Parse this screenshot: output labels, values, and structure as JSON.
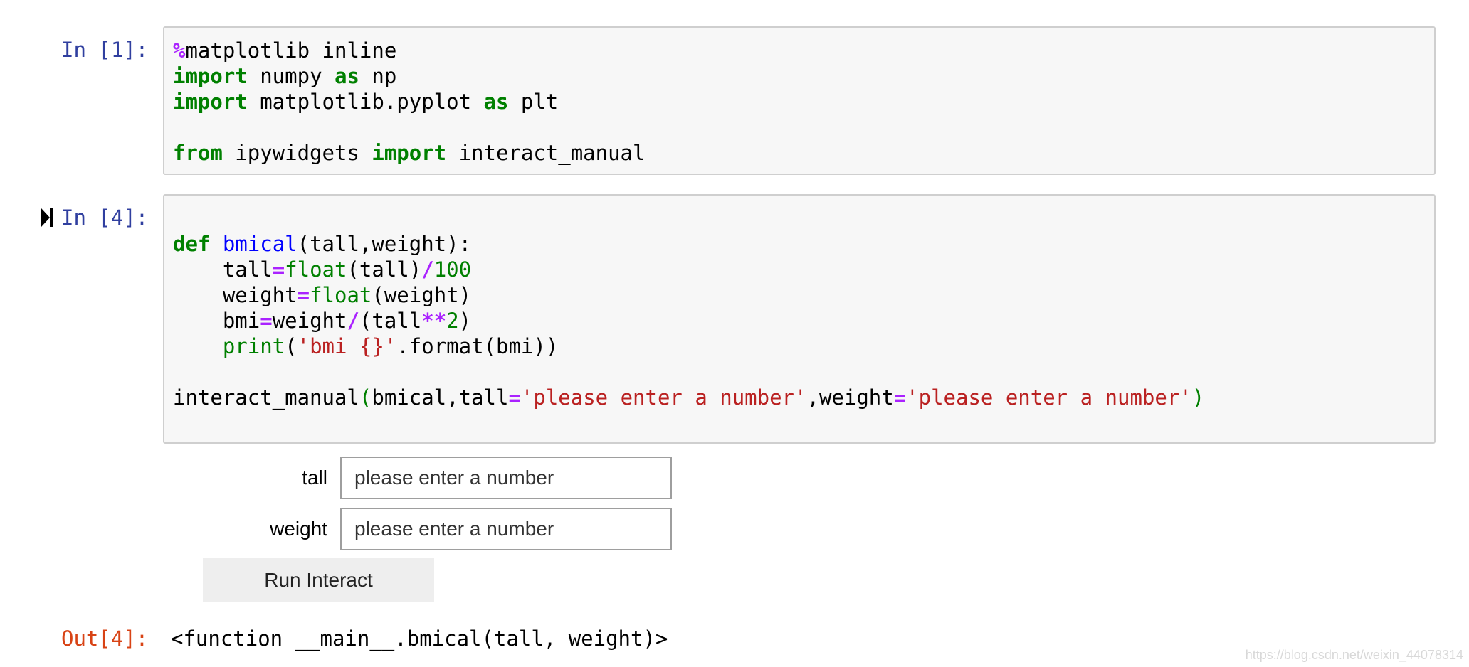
{
  "cells": [
    {
      "prompt": "In [1]:",
      "code_lines": [
        [
          {
            "t": "op",
            "v": "%"
          },
          {
            "t": "plain",
            "v": "matplotlib inline"
          }
        ],
        [
          {
            "t": "kw",
            "v": "import"
          },
          {
            "t": "plain",
            "v": " numpy "
          },
          {
            "t": "kw",
            "v": "as"
          },
          {
            "t": "plain",
            "v": " np"
          }
        ],
        [
          {
            "t": "kw",
            "v": "import"
          },
          {
            "t": "plain",
            "v": " matplotlib.pyplot "
          },
          {
            "t": "kw",
            "v": "as"
          },
          {
            "t": "plain",
            "v": " plt"
          }
        ],
        [],
        [
          {
            "t": "kw",
            "v": "from"
          },
          {
            "t": "plain",
            "v": " ipywidgets "
          },
          {
            "t": "kw",
            "v": "import"
          },
          {
            "t": "plain",
            "v": " interact_manual"
          }
        ]
      ]
    },
    {
      "prompt": "In [4]:",
      "code_lines": [
        [],
        [
          {
            "t": "kw",
            "v": "def"
          },
          {
            "t": "plain",
            "v": " "
          },
          {
            "t": "fn",
            "v": "bmical"
          },
          {
            "t": "plain",
            "v": "(tall,weight):"
          }
        ],
        [
          {
            "t": "plain",
            "v": "    tall"
          },
          {
            "t": "op",
            "v": "="
          },
          {
            "t": "bi",
            "v": "float"
          },
          {
            "t": "plain",
            "v": "(tall)"
          },
          {
            "t": "op",
            "v": "/"
          },
          {
            "t": "num",
            "v": "100"
          }
        ],
        [
          {
            "t": "plain",
            "v": "    weight"
          },
          {
            "t": "op",
            "v": "="
          },
          {
            "t": "bi",
            "v": "float"
          },
          {
            "t": "plain",
            "v": "(weight)"
          }
        ],
        [
          {
            "t": "plain",
            "v": "    bmi"
          },
          {
            "t": "op",
            "v": "="
          },
          {
            "t": "plain",
            "v": "weight"
          },
          {
            "t": "op",
            "v": "/"
          },
          {
            "t": "plain",
            "v": "(tall"
          },
          {
            "t": "op",
            "v": "**"
          },
          {
            "t": "num",
            "v": "2"
          },
          {
            "t": "plain",
            "v": ")"
          }
        ],
        [
          {
            "t": "plain",
            "v": "    "
          },
          {
            "t": "bi",
            "v": "print"
          },
          {
            "t": "plain",
            "v": "("
          },
          {
            "t": "str",
            "v": "'bmi {}'"
          },
          {
            "t": "plain",
            "v": ".format(bmi))"
          }
        ],
        [],
        [
          {
            "t": "plain",
            "v": "interact_manual"
          },
          {
            "t": "paren",
            "v": "("
          },
          {
            "t": "plain",
            "v": "bmical,tall"
          },
          {
            "t": "op",
            "v": "="
          },
          {
            "t": "str",
            "v": "'please enter a number'"
          },
          {
            "t": "plain",
            "v": ",weight"
          },
          {
            "t": "op",
            "v": "="
          },
          {
            "t": "str",
            "v": "'please enter a number'"
          },
          {
            "t": "paren",
            "v": ")"
          }
        ],
        []
      ]
    }
  ],
  "widgets": {
    "tall": {
      "label": "tall",
      "value": "please enter a number"
    },
    "weight": {
      "label": "weight",
      "value": "please enter a number"
    },
    "run_button_label": "Run Interact"
  },
  "output": {
    "prompt": "Out[4]:",
    "text": "<function __main__.bmical(tall, weight)>"
  },
  "watermark": "https://blog.csdn.net/weixin_44078314",
  "colors": {
    "prompt_in": "#303f9f",
    "prompt_out": "#d84315",
    "keyword": "#008000",
    "operator": "#aa22ff",
    "string": "#ba2121",
    "function_name": "#0000ff"
  }
}
